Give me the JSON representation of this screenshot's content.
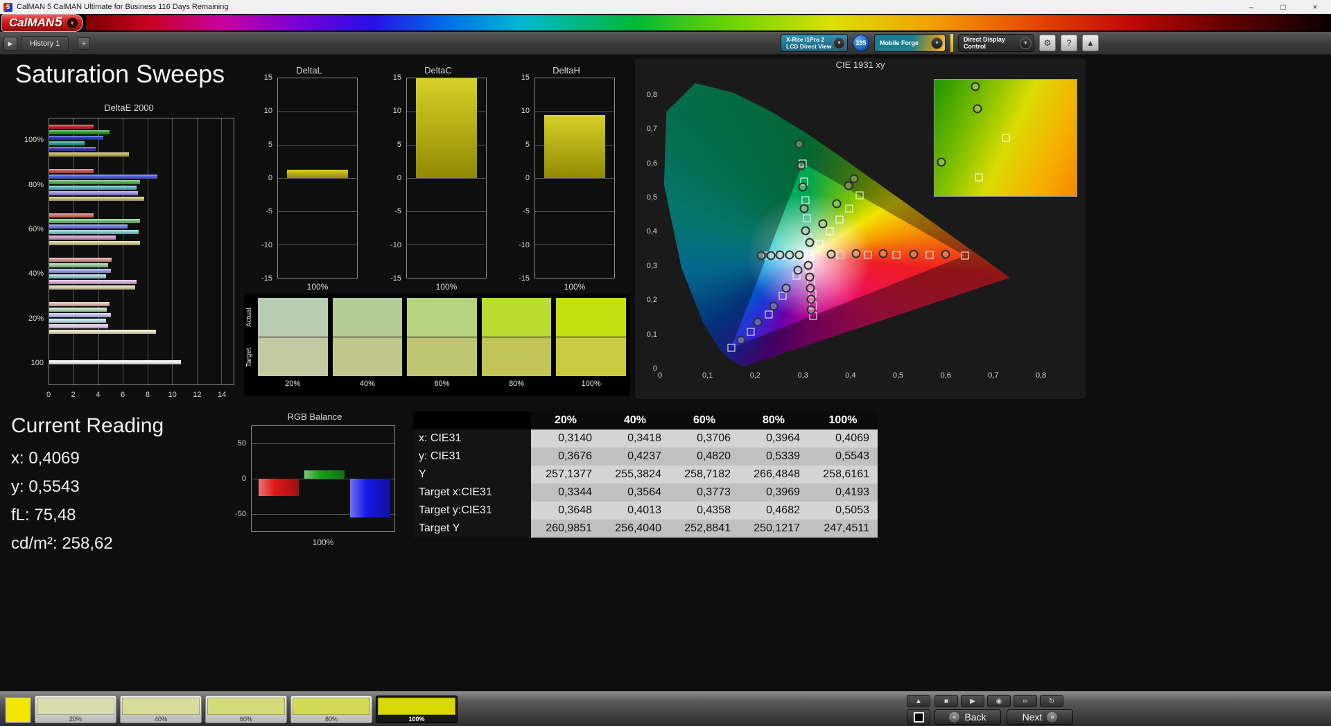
{
  "titlebar": {
    "app_icon": "5",
    "title": "CalMAN 5 CalMAN Ultimate for Business 116 Days Remaining",
    "minimize": "–",
    "maximize": "□",
    "close": "×"
  },
  "logobar": {
    "logo_main": "CalMAN",
    "logo_5": "5",
    "chevron": "▼"
  },
  "tabbar": {
    "nav_arrow": "▶",
    "history_tab": "History 1",
    "add_tab": "+",
    "meter_line1": "X-Rite i1Pro 2",
    "meter_line2": "LCD Direct View",
    "badge": "235",
    "workflow": "Mobile Forge",
    "display_control": "Direct Display Control",
    "chevron": "▼",
    "gear_icon": "⚙",
    "help_icon": "?",
    "collapse_icon": "▲"
  },
  "page": {
    "title": "Saturation Sweeps"
  },
  "current_reading": {
    "title": "Current Reading",
    "lines": [
      "x: 0,4069",
      "y: 0,5543",
      "fL: 75,48",
      "cd/m²: 258,62"
    ]
  },
  "swatch_compare": {
    "row_labels": [
      "Actual",
      "Target"
    ],
    "columns": [
      {
        "label": "20%",
        "actual": "#b9cdb2",
        "target": "#c3c9a0"
      },
      {
        "label": "40%",
        "actual": "#b3cb97",
        "target": "#bfc78d"
      },
      {
        "label": "60%",
        "actual": "#b6d47d",
        "target": "#bfc471"
      },
      {
        "label": "80%",
        "actual": "#b8dc30",
        "target": "#c2c558"
      },
      {
        "label": "100%",
        "actual": "#c4de10",
        "target": "#c8cb40"
      }
    ]
  },
  "table": {
    "columns": [
      "",
      "20%",
      "40%",
      "60%",
      "80%",
      "100%"
    ],
    "rows": [
      {
        "label": "x: CIE31",
        "values": [
          "0,3140",
          "0,3418",
          "0,3706",
          "0,3964",
          "0,4069"
        ]
      },
      {
        "label": "y: CIE31",
        "values": [
          "0,3676",
          "0,4237",
          "0,4820",
          "0,5339",
          "0,5543"
        ]
      },
      {
        "label": "Y",
        "values": [
          "257,1377",
          "255,3824",
          "258,7182",
          "266,4848",
          "258,6161"
        ]
      },
      {
        "label": "Target x:CIE31",
        "values": [
          "0,3344",
          "0,3564",
          "0,3773",
          "0,3969",
          "0,4193"
        ]
      },
      {
        "label": "Target y:CIE31",
        "values": [
          "0,3648",
          "0,4013",
          "0,4358",
          "0,4682",
          "0,5053"
        ]
      },
      {
        "label": "Target Y",
        "values": [
          "260,9851",
          "256,4040",
          "252,8841",
          "250,1217",
          "247,4511"
        ]
      }
    ]
  },
  "bottombar": {
    "current_color": "#f3e600",
    "swatches": [
      {
        "label": "20%",
        "color": "#d9dcae",
        "selected": false
      },
      {
        "label": "40%",
        "color": "#d8dc9a",
        "selected": false
      },
      {
        "label": "60%",
        "color": "#d3da7a",
        "selected": false
      },
      {
        "label": "80%",
        "color": "#d0da55",
        "selected": false
      },
      {
        "label": "100%",
        "color": "#d8d900",
        "selected": true
      }
    ],
    "controls": {
      "collapse": "▲",
      "stop": "■",
      "play": "▶",
      "record": "◉",
      "loop": "∞",
      "refresh": "↻",
      "back_label": "Back",
      "next_label": "Next",
      "back_icon": "«",
      "next_icon": "»"
    }
  },
  "chart_data": {
    "deltaE2000": {
      "type": "bar",
      "orientation": "horizontal",
      "title": "DeltaE 2000",
      "xlim": [
        0,
        15
      ],
      "xticks": [
        0,
        2,
        4,
        6,
        8,
        10,
        12,
        14
      ],
      "groups": [
        {
          "label": "100%",
          "bars": [
            {
              "color": "#c22828",
              "value": 3.6
            },
            {
              "color": "#28a028",
              "value": 4.9
            },
            {
              "color": "#2838c8",
              "value": 4.4
            },
            {
              "color": "#28a0a0",
              "value": 2.9
            },
            {
              "color": "#3838a0",
              "value": 3.8
            },
            {
              "color": "#c0b050",
              "value": 6.5
            }
          ]
        },
        {
          "label": "80%",
          "bars": [
            {
              "color": "#c85050",
              "value": 3.6
            },
            {
              "color": "#5060d8",
              "value": 8.8
            },
            {
              "color": "#50b058",
              "value": 7.4
            },
            {
              "color": "#60b8c8",
              "value": 7.1
            },
            {
              "color": "#9890d8",
              "value": 7.2
            },
            {
              "color": "#c8b878",
              "value": 7.7
            }
          ]
        },
        {
          "label": "60%",
          "bars": [
            {
              "color": "#d07068",
              "value": 3.6
            },
            {
              "color": "#70c078",
              "value": 7.4
            },
            {
              "color": "#7080e0",
              "value": 6.4
            },
            {
              "color": "#80c8d0",
              "value": 7.3
            },
            {
              "color": "#d098c8",
              "value": 5.4
            },
            {
              "color": "#d0c890",
              "value": 7.4
            }
          ]
        },
        {
          "label": "40%",
          "bars": [
            {
              "color": "#d89890",
              "value": 5.1
            },
            {
              "color": "#98cc98",
              "value": 4.8
            },
            {
              "color": "#98a0e8",
              "value": 5.0
            },
            {
              "color": "#a0d0d8",
              "value": 4.6
            },
            {
              "color": "#d8b0d8",
              "value": 7.1
            },
            {
              "color": "#d8d0a8",
              "value": 7.0
            }
          ]
        },
        {
          "label": "20%",
          "bars": [
            {
              "color": "#e0b8b0",
              "value": 4.9
            },
            {
              "color": "#b8dcb8",
              "value": 4.7
            },
            {
              "color": "#b8c0f0",
              "value": 5.0
            },
            {
              "color": "#c0e0e8",
              "value": 4.6
            },
            {
              "color": "#e0c8e0",
              "value": 4.8
            },
            {
              "color": "#e8e0c0",
              "value": 8.7
            }
          ]
        },
        {
          "label": "100",
          "bars": [
            {
              "color": "#f0f0f0",
              "value": 10.7
            }
          ]
        }
      ]
    },
    "deltaL": {
      "type": "bar",
      "title": "DeltaL",
      "ylim": [
        -15,
        15
      ],
      "yticks": [
        15,
        10,
        5,
        0,
        -5,
        -10,
        -15
      ],
      "xlabel": "100%",
      "value": 1.3,
      "colors": [
        "#d8d02a",
        "#8f8a00"
      ]
    },
    "deltaC": {
      "type": "bar",
      "title": "DeltaC",
      "ylim": [
        -15,
        15
      ],
      "yticks": [
        15,
        10,
        5,
        0,
        -5,
        -10,
        -15
      ],
      "xlabel": "100%",
      "value": 15,
      "colors": [
        "#d8d02a",
        "#8f8a00"
      ]
    },
    "deltaH": {
      "type": "bar",
      "title": "DeltaH",
      "ylim": [
        -15,
        15
      ],
      "yticks": [
        15,
        10,
        5,
        0,
        -5,
        -10,
        -15
      ],
      "xlabel": "100%",
      "value": 9.5,
      "colors": [
        "#d8d02a",
        "#8f8a00"
      ]
    },
    "rgb_balance": {
      "type": "bar",
      "title": "RGB Balance",
      "ylim": [
        -75,
        75
      ],
      "yticks": [
        50,
        0,
        -50
      ],
      "xlabel": "100%",
      "series": [
        {
          "name": "Red",
          "value": -25,
          "color": "#e01818"
        },
        {
          "name": "Green",
          "value": 12,
          "color": "#18a018"
        },
        {
          "name": "Blue",
          "value": -55,
          "color": "#1818e8"
        }
      ]
    },
    "cie": {
      "type": "scatter",
      "title": "CIE 1931 xy",
      "xlim": [
        0,
        0.85
      ],
      "ylim": [
        0,
        0.85
      ],
      "xticks": [
        "0",
        "0,1",
        "0,2",
        "0,3",
        "0,4",
        "0,5",
        "0,6",
        "0,7",
        "0,8"
      ],
      "yticks": [
        "0",
        "0,1",
        "0,2",
        "0,3",
        "0,4",
        "0,5",
        "0,6",
        "0,7",
        "0,8"
      ],
      "white_point": [
        0.3127,
        0.329
      ],
      "targets": [
        [
          0.379,
          0.331
        ],
        [
          0.437,
          0.332
        ],
        [
          0.497,
          0.332
        ],
        [
          0.566,
          0.331
        ],
        [
          0.64,
          0.33
        ],
        [
          0.311,
          0.385
        ],
        [
          0.309,
          0.44
        ],
        [
          0.306,
          0.492
        ],
        [
          0.303,
          0.546
        ],
        [
          0.3,
          0.6
        ],
        [
          0.287,
          0.272
        ],
        [
          0.258,
          0.213
        ],
        [
          0.228,
          0.158
        ],
        [
          0.19,
          0.108
        ],
        [
          0.15,
          0.06
        ],
        [
          0.296,
          0.33
        ],
        [
          0.279,
          0.33
        ],
        [
          0.262,
          0.33
        ],
        [
          0.244,
          0.33
        ],
        [
          0.225,
          0.329
        ],
        [
          0.315,
          0.291
        ],
        [
          0.318,
          0.254
        ],
        [
          0.32,
          0.218
        ],
        [
          0.322,
          0.184
        ],
        [
          0.321,
          0.154
        ],
        [
          0.3344,
          0.3648
        ],
        [
          0.3564,
          0.4013
        ],
        [
          0.3773,
          0.4358
        ],
        [
          0.3969,
          0.4682
        ],
        [
          0.4193,
          0.5053
        ]
      ],
      "measured": [
        [
          0.314,
          0.3676
        ],
        [
          0.3418,
          0.4237
        ],
        [
          0.3706,
          0.482
        ],
        [
          0.3964,
          0.5339
        ],
        [
          0.4069,
          0.5543
        ],
        [
          0.306,
          0.402
        ],
        [
          0.303,
          0.468
        ],
        [
          0.3,
          0.53
        ],
        [
          0.297,
          0.592
        ],
        [
          0.293,
          0.655
        ],
        [
          0.36,
          0.334
        ],
        [
          0.412,
          0.335
        ],
        [
          0.468,
          0.335
        ],
        [
          0.532,
          0.334
        ],
        [
          0.6,
          0.334
        ],
        [
          0.29,
          0.287
        ],
        [
          0.265,
          0.235
        ],
        [
          0.238,
          0.183
        ],
        [
          0.205,
          0.135
        ],
        [
          0.17,
          0.082
        ],
        [
          0.293,
          0.331
        ],
        [
          0.272,
          0.331
        ],
        [
          0.252,
          0.331
        ],
        [
          0.233,
          0.33
        ],
        [
          0.213,
          0.329
        ],
        [
          0.312,
          0.302
        ],
        [
          0.314,
          0.268
        ],
        [
          0.316,
          0.235
        ],
        [
          0.317,
          0.203
        ],
        [
          0.318,
          0.172
        ]
      ],
      "inset": {
        "squares": [
          [
            0.5,
            0.5
          ],
          [
            0.31,
            0.84
          ]
        ],
        "circles": [
          [
            0.29,
            0.06
          ],
          [
            0.3,
            0.25
          ],
          [
            0.05,
            0.71
          ]
        ]
      }
    }
  }
}
